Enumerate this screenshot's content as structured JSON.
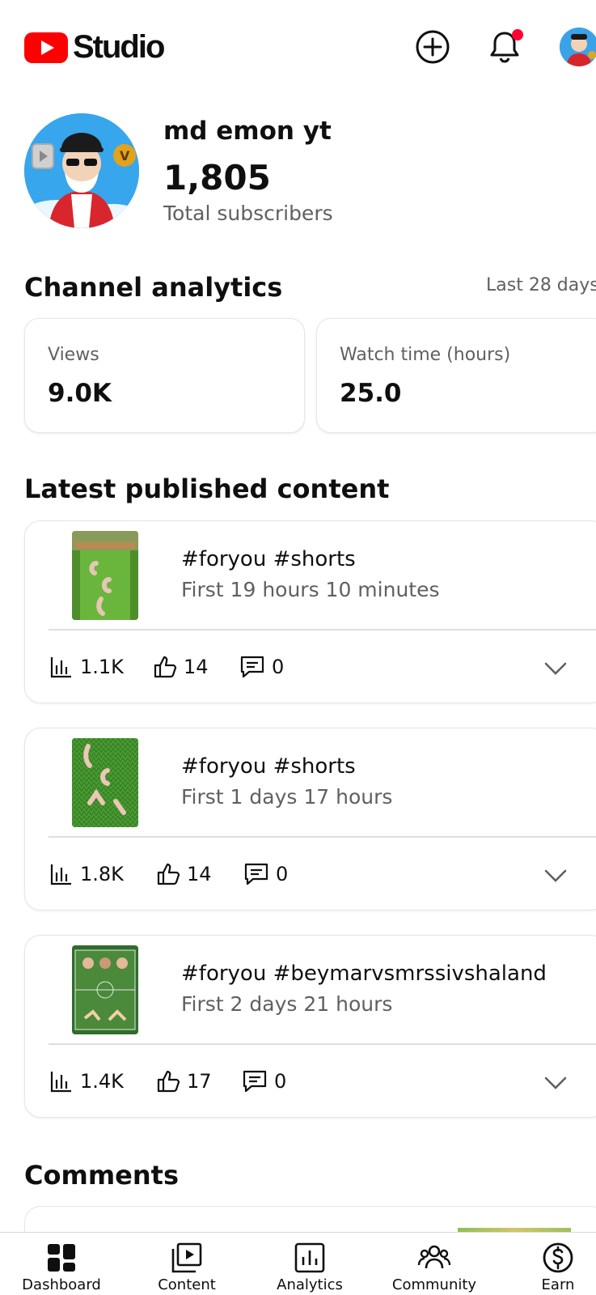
{
  "header": {
    "brand": "Studio",
    "create_icon": "create-plus-icon",
    "notifications_icon": "bell-icon",
    "accent": "#ff0000"
  },
  "profile": {
    "channel_name": "md emon yt",
    "subscribers": "1,805",
    "subscribers_label": "Total subscribers"
  },
  "analytics": {
    "title": "Channel analytics",
    "range": "Last 28 days",
    "cards": [
      {
        "label": "Views",
        "value": "9.0K"
      },
      {
        "label": "Watch time (hours)",
        "value": "25.0"
      }
    ]
  },
  "latest": {
    "title": "Latest published content",
    "videos": [
      {
        "title": "#foryou #shorts",
        "subtitle": "First 19 hours 10 minutes",
        "views": "1.1K",
        "likes": "14",
        "comments": "0"
      },
      {
        "title": "#foryou #shorts",
        "subtitle": "First 1 days 17 hours",
        "views": "1.8K",
        "likes": "14",
        "comments": "0"
      },
      {
        "title": "#foryou #beymarvsmrssivshaland",
        "subtitle": "First 2 days 21 hours",
        "views": "1.4K",
        "likes": "17",
        "comments": "0"
      }
    ]
  },
  "comments": {
    "title": "Comments"
  },
  "nav": {
    "items": [
      {
        "label": "Dashboard",
        "icon": "dashboard-icon"
      },
      {
        "label": "Content",
        "icon": "content-icon"
      },
      {
        "label": "Analytics",
        "icon": "analytics-icon"
      },
      {
        "label": "Community",
        "icon": "community-icon"
      },
      {
        "label": "Earn",
        "icon": "earn-dollar-icon"
      }
    ]
  }
}
